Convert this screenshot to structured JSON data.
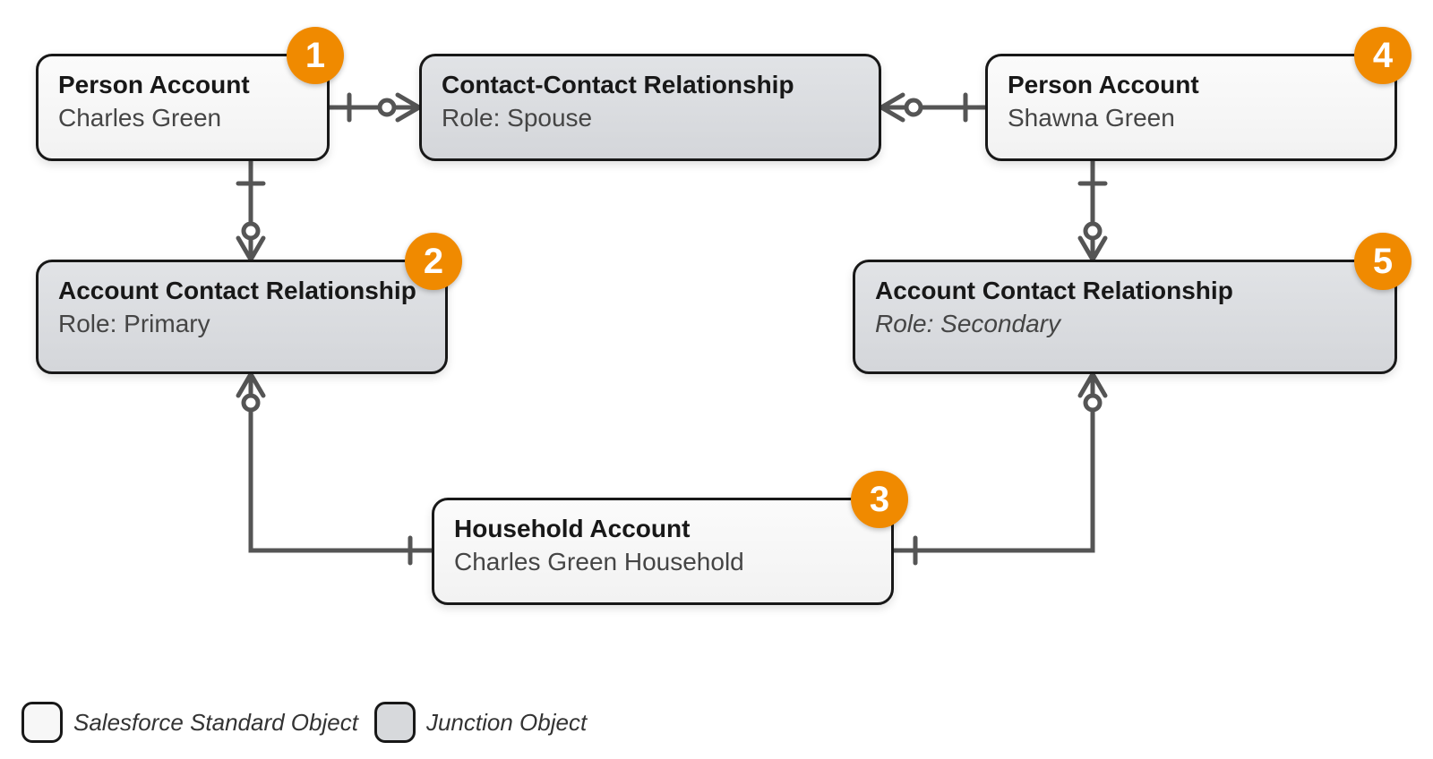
{
  "nodes": {
    "n1": {
      "title": "Person Account",
      "sub": "Charles Green",
      "badge": "1"
    },
    "n2": {
      "title": "Account Contact Relationship",
      "sub": "Role: Primary",
      "badge": "2"
    },
    "n3": {
      "title": "Household Account",
      "sub": "Charles Green Household",
      "badge": "3"
    },
    "n4": {
      "title": "Person Account",
      "sub": "Shawna Green",
      "badge": "4"
    },
    "n5": {
      "title": "Account Contact Relationship",
      "sub": "Role: Secondary",
      "badge": "5"
    },
    "ccr": {
      "title": "Contact-Contact Relationship",
      "sub": "Role: Spouse"
    }
  },
  "legend": {
    "standard": "Salesforce Standard Object",
    "junction": "Junction Object"
  }
}
